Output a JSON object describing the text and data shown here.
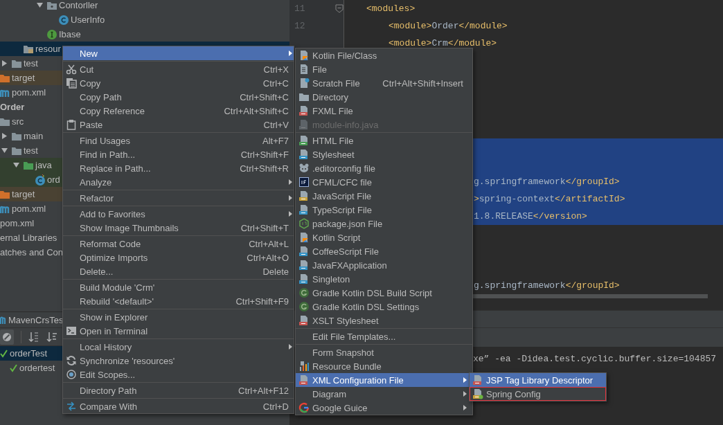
{
  "project_tree": [
    {
      "children": [
        {
          "children": [
            {
              "children": [
                {
                  "children": [
                    {
                      "children": [
                        {
                          "label": "Contorller",
                          "kind": "package",
                          "expanded": true,
                          "selected": false,
                          "children": [
                            {
                              "label": "UserInfo",
                              "kind": "class",
                              "selected": false
                            }
                          ]
                        },
                        {
                          "label": "Ibase",
                          "kind": "interface",
                          "selected": false
                        }
                      ]
                    }
                  ]
                },
                {
                  "label": "resour",
                  "kind": "resources",
                  "selected": true
                }
              ]
            },
            {
              "label": "test",
              "kind": "folder",
              "expanded": false,
              "selected": false
            }
          ]
        },
        {
          "label": "target",
          "kind": "excluded",
          "selected": false
        },
        {
          "label": "pom.xml",
          "kind": "maven",
          "selected": false
        }
      ]
    },
    {
      "label": "Order",
      "kind": "module",
      "selected": false,
      "children": [
        {
          "label": "src",
          "kind": "folder",
          "selected": false,
          "children": [
            {
              "label": "main",
              "kind": "folder",
              "expanded": false,
              "selected": false
            },
            {
              "label": "test",
              "kind": "folder",
              "expanded": true,
              "selected": false,
              "children": [
                {
                  "label": "java",
                  "kind": "test-sources",
                  "expanded": true,
                  "selected": false,
                  "children": [
                    {
                      "label": "ord",
                      "kind": "test-class",
                      "selected": false
                    }
                  ]
                }
              ]
            }
          ]
        },
        {
          "label": "target",
          "kind": "excluded",
          "selected": false
        },
        {
          "label": "pom.xml",
          "kind": "maven",
          "selected": false
        }
      ]
    },
    {
      "label": "pom.xml",
      "kind": "maven",
      "selected": false
    },
    {
      "label": "ernal Libraries",
      "kind": "plain",
      "selected": false
    },
    {
      "label": "atches and Con",
      "kind": "plain",
      "selected": false
    }
  ],
  "test_panel": {
    "tab": "MavenCrsTes",
    "tree": [
      {
        "label": "orderTest",
        "selected": true,
        "children": [
          {
            "label": "ordertest",
            "selected": false
          }
        ]
      }
    ]
  },
  "editor": {
    "line_numbers": [
      "11",
      "12"
    ],
    "lines": [
      {
        "kind": "tag",
        "text": "<modules>",
        "selected": false
      },
      {
        "kind": "child",
        "text": "<module>Order</module>",
        "selected": false
      },
      {
        "kind": "child",
        "text": "<module>Crm</module>",
        "selected": false
      },
      {
        "selected": false
      },
      {
        "selected": false
      },
      {
        "selected": false
      },
      {
        "selected": false
      },
      {
        "selected": false
      },
      {
        "selected": true
      },
      {
        "selected": true
      },
      {
        "kind": "fragment",
        "text": "g.springframework</groupId>",
        "selected": true
      },
      {
        "kind": "fragment",
        "text": ">spring-context</artifactId>",
        "selected": true
      },
      {
        "kind": "fragment",
        "text": "1.8.RELEASE</version>",
        "selected": true
      },
      {
        "selected": false
      },
      {
        "selected": false
      },
      {
        "selected": false
      },
      {
        "kind": "fragment",
        "text": "g.springframework</groupId>",
        "selected": false
      }
    ],
    "console_lines": [
      "xe” -ea -Didea.test.cyclic.buffer.size=104857"
    ]
  },
  "context_menu": {
    "items": [
      {
        "kind": "item",
        "label": "New",
        "selected": true,
        "submenu": true
      },
      {
        "kind": "separator"
      },
      {
        "kind": "item",
        "label": "Cut",
        "shortcut": "Ctrl+X",
        "selected": false,
        "submenu": false
      },
      {
        "kind": "item",
        "label": "Copy",
        "shortcut": "Ctrl+C",
        "selected": false,
        "submenu": false
      },
      {
        "kind": "item",
        "label": "Copy Path",
        "shortcut": "Ctrl+Shift+C",
        "selected": false,
        "submenu": false
      },
      {
        "kind": "item",
        "label": "Copy Reference",
        "shortcut": "Ctrl+Alt+Shift+C",
        "selected": false,
        "submenu": false
      },
      {
        "kind": "item",
        "label": "Paste",
        "shortcut": "Ctrl+V",
        "selected": false,
        "submenu": false
      },
      {
        "kind": "separator"
      },
      {
        "kind": "item",
        "label": "Find Usages",
        "shortcut": "Alt+F7",
        "selected": false,
        "submenu": false
      },
      {
        "kind": "item",
        "label": "Find in Path...",
        "shortcut": "Ctrl+Shift+F",
        "selected": false,
        "submenu": false
      },
      {
        "kind": "item",
        "label": "Replace in Path...",
        "shortcut": "Ctrl+Shift+R",
        "selected": false,
        "submenu": false
      },
      {
        "kind": "item",
        "label": "Analyze",
        "selected": false,
        "submenu": true
      },
      {
        "kind": "separator"
      },
      {
        "kind": "item",
        "label": "Refactor",
        "selected": false,
        "submenu": true
      },
      {
        "kind": "separator"
      },
      {
        "kind": "item",
        "label": "Add to Favorites",
        "selected": false,
        "submenu": true
      },
      {
        "kind": "item",
        "label": "Show Image Thumbnails",
        "shortcut": "Ctrl+Shift+T",
        "selected": false,
        "submenu": false
      },
      {
        "kind": "separator"
      },
      {
        "kind": "item",
        "label": "Reformat Code",
        "shortcut": "Ctrl+Alt+L",
        "selected": false,
        "submenu": false
      },
      {
        "kind": "item",
        "label": "Optimize Imports",
        "shortcut": "Ctrl+Alt+O",
        "selected": false,
        "submenu": false
      },
      {
        "kind": "item",
        "label": "Delete...",
        "shortcut": "Delete",
        "selected": false,
        "submenu": false
      },
      {
        "kind": "separator"
      },
      {
        "kind": "item",
        "label": "Build Module 'Crm'",
        "selected": false,
        "submenu": false
      },
      {
        "kind": "item",
        "label": "Rebuild '<default>'",
        "shortcut": "Ctrl+Shift+F9",
        "selected": false,
        "submenu": false
      },
      {
        "kind": "separator"
      },
      {
        "kind": "item",
        "label": "Show in Explorer",
        "selected": false,
        "submenu": false
      },
      {
        "kind": "item",
        "label": "Open in Terminal",
        "selected": false,
        "submenu": false
      },
      {
        "kind": "separator"
      },
      {
        "kind": "item",
        "label": "Local History",
        "selected": false,
        "submenu": true
      },
      {
        "kind": "item",
        "label": "Synchronize 'resources'",
        "selected": false,
        "submenu": false
      },
      {
        "kind": "item",
        "label": "Edit Scopes...",
        "selected": false,
        "submenu": false
      },
      {
        "kind": "separator"
      },
      {
        "kind": "item",
        "label": "Directory Path",
        "shortcut": "Ctrl+Alt+F12",
        "selected": false,
        "submenu": false
      },
      {
        "kind": "separator"
      },
      {
        "kind": "item",
        "label": "Compare With",
        "shortcut": "Ctrl+D",
        "selected": false,
        "submenu": false
      }
    ]
  },
  "new_submenu": {
    "items": [
      {
        "kind": "item",
        "label": "Kotlin File/Class",
        "selected": false,
        "disabled": false,
        "submenu": false
      },
      {
        "kind": "item",
        "label": "File",
        "selected": false,
        "disabled": false,
        "submenu": false
      },
      {
        "kind": "item",
        "label": "Scratch File",
        "shortcut": "Ctrl+Alt+Shift+Insert",
        "selected": false,
        "disabled": false,
        "submenu": false
      },
      {
        "kind": "item",
        "label": "Directory",
        "selected": false,
        "disabled": false,
        "submenu": false
      },
      {
        "kind": "item",
        "label": "FXML File",
        "selected": false,
        "disabled": false,
        "submenu": false
      },
      {
        "kind": "item",
        "label": "module-info.java",
        "selected": false,
        "disabled": true,
        "submenu": false
      },
      {
        "kind": "separator"
      },
      {
        "kind": "item",
        "label": "HTML File",
        "selected": false,
        "disabled": false,
        "submenu": false
      },
      {
        "kind": "item",
        "label": "Stylesheet",
        "selected": false,
        "disabled": false,
        "submenu": false
      },
      {
        "kind": "item",
        "label": ".editorconfig file",
        "selected": false,
        "disabled": false,
        "submenu": false
      },
      {
        "kind": "item",
        "label": "CFML/CFC file",
        "selected": false,
        "disabled": false,
        "submenu": false
      },
      {
        "kind": "item",
        "label": "JavaScript File",
        "selected": false,
        "disabled": false,
        "submenu": false
      },
      {
        "kind": "item",
        "label": "TypeScript File",
        "selected": false,
        "disabled": false,
        "submenu": false
      },
      {
        "kind": "item",
        "label": "package.json File",
        "selected": false,
        "disabled": false,
        "submenu": false
      },
      {
        "kind": "item",
        "label": "Kotlin Script",
        "selected": false,
        "disabled": false,
        "submenu": false
      },
      {
        "kind": "item",
        "label": "CoffeeScript File",
        "selected": false,
        "disabled": false,
        "submenu": false
      },
      {
        "kind": "item",
        "label": "JavaFXApplication",
        "selected": false,
        "disabled": false,
        "submenu": false
      },
      {
        "kind": "item",
        "label": "Singleton",
        "selected": false,
        "disabled": false,
        "submenu": false
      },
      {
        "kind": "item",
        "label": "Gradle Kotlin DSL Build Script",
        "selected": false,
        "disabled": false,
        "submenu": false
      },
      {
        "kind": "item",
        "label": "Gradle Kotlin DSL Settings",
        "selected": false,
        "disabled": false,
        "submenu": false
      },
      {
        "kind": "item",
        "label": "XSLT Stylesheet",
        "selected": false,
        "disabled": false,
        "submenu": false
      },
      {
        "kind": "separator"
      },
      {
        "kind": "item",
        "label": "Edit File Templates...",
        "selected": false,
        "disabled": false,
        "submenu": false
      },
      {
        "kind": "separator"
      },
      {
        "kind": "item",
        "label": "Form Snapshot",
        "selected": false,
        "disabled": false,
        "submenu": false
      },
      {
        "kind": "item",
        "label": "Resource Bundle",
        "selected": false,
        "disabled": false,
        "submenu": false
      },
      {
        "kind": "item",
        "label": "XML Configuration File",
        "selected": true,
        "disabled": false,
        "submenu": true
      },
      {
        "kind": "item",
        "label": "Diagram",
        "selected": false,
        "disabled": false,
        "submenu": true
      },
      {
        "kind": "item",
        "label": "Google Guice",
        "selected": false,
        "disabled": false,
        "submenu": true
      }
    ]
  },
  "xml_submenu": {
    "items": [
      {
        "kind": "item",
        "label": "JSP Tag Library Descriptor",
        "selected": true,
        "annotated": false
      },
      {
        "kind": "item",
        "label": "Spring Config",
        "selected": false,
        "annotated": true
      }
    ]
  }
}
